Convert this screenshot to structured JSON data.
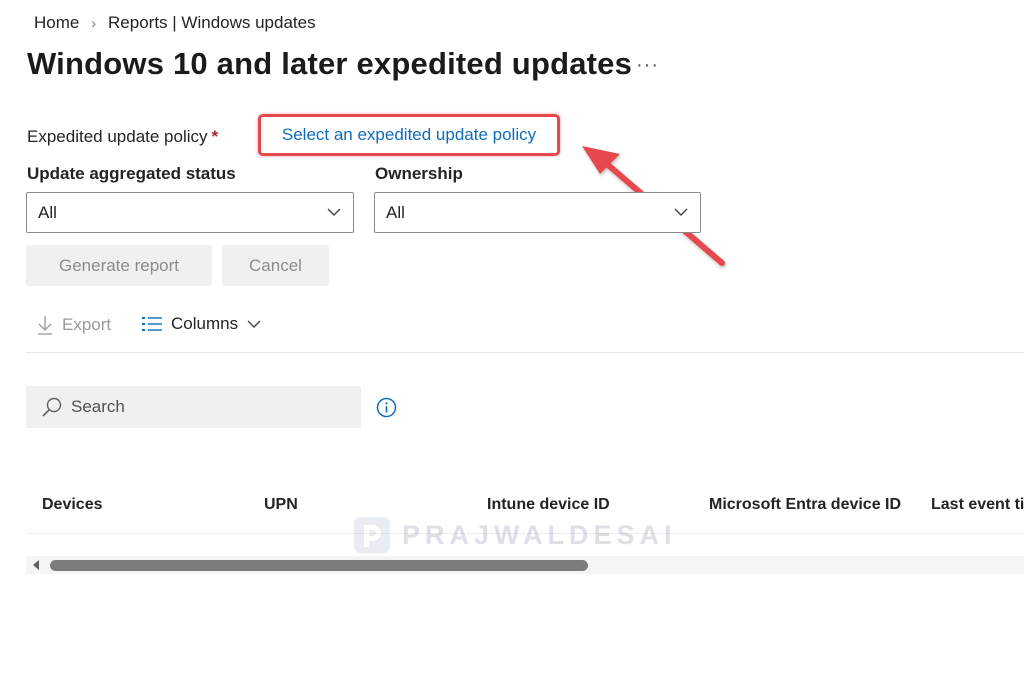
{
  "breadcrumb": {
    "home": "Home",
    "separator": "›",
    "current": "Reports | Windows updates"
  },
  "page": {
    "title": "Windows 10 and later expedited updates",
    "more_label": "···"
  },
  "policy": {
    "label": "Expedited update policy",
    "required_marker": "*",
    "link_text": "Select an expedited update policy",
    "highlight_color": "#e5484d"
  },
  "filters": {
    "update_status": {
      "label": "Update aggregated status",
      "value": "All"
    },
    "ownership": {
      "label": "Ownership",
      "value": "All"
    }
  },
  "buttons": {
    "generate": "Generate report",
    "cancel": "Cancel"
  },
  "toolbar": {
    "export": "Export",
    "columns": "Columns"
  },
  "search": {
    "placeholder": "Search"
  },
  "table": {
    "columns": [
      "Devices",
      "UPN",
      "Intune device ID",
      "Microsoft Entra device ID",
      "Last event ti"
    ]
  },
  "watermark": {
    "text": "PRAJWALDESAI"
  },
  "colors": {
    "link": "#0f6cbd",
    "required": "#a4262c",
    "annotation_arrow": "#e5484d"
  },
  "icons": [
    "chevron-right-icon",
    "more-icon",
    "chevron-down-icon",
    "download-icon",
    "list-icon",
    "search-icon",
    "info-icon",
    "scroll-left-icon",
    "arrow-annotation"
  ]
}
